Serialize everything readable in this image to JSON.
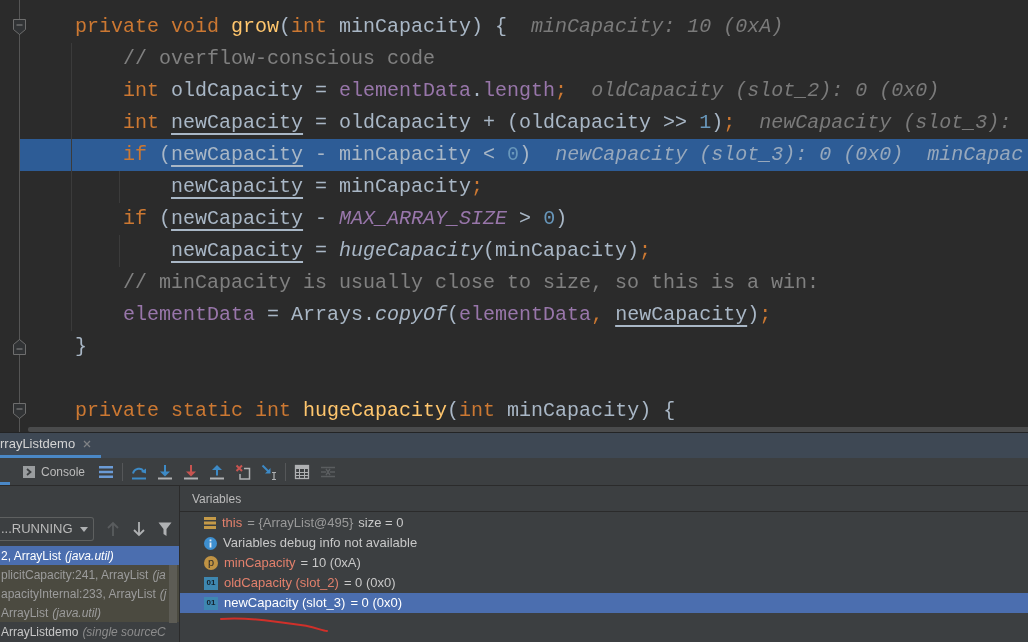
{
  "editor": {
    "lines": [
      {
        "kind": "code",
        "fold_start": true,
        "current": false,
        "tokens": [
          {
            "kind": "keyword",
            "text": "private "
          },
          {
            "kind": "keyword",
            "text": "void "
          },
          {
            "kind": "declaration",
            "text": "grow"
          },
          {
            "kind": "plain",
            "text": "("
          },
          {
            "kind": "keyword",
            "text": "int "
          },
          {
            "kind": "plain",
            "text": "minCapacity) {"
          }
        ],
        "hints": [
          "minCapacity: 10 (0xA)"
        ],
        "children": [
          {
            "kind": "code",
            "current": false,
            "tokens": [
              {
                "kind": "comment",
                "text": "// overflow-conscious code"
              }
            ]
          },
          {
            "kind": "code",
            "current": false,
            "tokens": [
              {
                "kind": "keyword",
                "text": "int "
              },
              {
                "kind": "plain",
                "text": "oldCapacity = "
              },
              {
                "kind": "field",
                "text": "elementData"
              },
              {
                "kind": "plain",
                "text": "."
              },
              {
                "kind": "field",
                "text": "length"
              },
              {
                "kind": "keyword",
                "text": ";"
              }
            ],
            "hints": [
              "oldCapacity (slot_2): 0 (0x0)"
            ]
          },
          {
            "kind": "code",
            "current": false,
            "tokens": [
              {
                "kind": "keyword",
                "text": "int "
              },
              {
                "kind": "local",
                "text": "newCapacity"
              },
              {
                "kind": "plain",
                "text": " = oldCapacity + (oldCapacity >> "
              },
              {
                "kind": "number",
                "text": "1"
              },
              {
                "kind": "plain",
                "text": ")"
              },
              {
                "kind": "keyword",
                "text": ";"
              }
            ],
            "hints": [
              "newCapacity (slot_3):"
            ]
          },
          {
            "kind": "code",
            "current": true,
            "tokens": [
              {
                "kind": "keyword",
                "text": "if "
              },
              {
                "kind": "plain",
                "text": "("
              },
              {
                "kind": "local",
                "text": "newCapacity"
              },
              {
                "kind": "plain",
                "text": " - minCapacity < "
              },
              {
                "kind": "number",
                "text": "0"
              },
              {
                "kind": "plain",
                "text": ")"
              }
            ],
            "hints": [
              "newCapacity (slot_3): 0 (0x0)",
              "minCapac"
            ],
            "children": [
              {
                "kind": "code",
                "current": false,
                "tokens": [
                  {
                    "kind": "local",
                    "text": "newCapacity"
                  },
                  {
                    "kind": "plain",
                    "text": " = minCapacity"
                  },
                  {
                    "kind": "keyword",
                    "text": ";"
                  }
                ]
              }
            ]
          },
          {
            "kind": "code",
            "current": false,
            "tokens": [
              {
                "kind": "keyword",
                "text": "if "
              },
              {
                "kind": "plain",
                "text": "("
              },
              {
                "kind": "local",
                "text": "newCapacity"
              },
              {
                "kind": "plain",
                "text": " - "
              },
              {
                "kind": "constant",
                "text": "MAX_ARRAY_SIZE"
              },
              {
                "kind": "plain",
                "text": " > "
              },
              {
                "kind": "number",
                "text": "0"
              },
              {
                "kind": "plain",
                "text": ")"
              }
            ],
            "children": [
              {
                "kind": "code",
                "current": false,
                "tokens": [
                  {
                    "kind": "local",
                    "text": "newCapacity"
                  },
                  {
                    "kind": "plain",
                    "text": " = "
                  },
                  {
                    "kind": "static_call",
                    "text": "hugeCapacity"
                  },
                  {
                    "kind": "plain",
                    "text": "(minCapacity)"
                  },
                  {
                    "kind": "keyword",
                    "text": ";"
                  }
                ]
              }
            ]
          },
          {
            "kind": "code",
            "current": false,
            "tokens": [
              {
                "kind": "comment",
                "text": "// minCapacity is usually close to size, so this is a win:"
              }
            ]
          },
          {
            "kind": "code",
            "current": false,
            "tokens": [
              {
                "kind": "field",
                "text": "elementData"
              },
              {
                "kind": "plain",
                "text": " = Arrays."
              },
              {
                "kind": "static_call",
                "text": "copyOf"
              },
              {
                "kind": "plain",
                "text": "("
              },
              {
                "kind": "field",
                "text": "elementData"
              },
              {
                "kind": "keyword",
                "text": ", "
              },
              {
                "kind": "local",
                "text": "newCapacity"
              },
              {
                "kind": "plain",
                "text": ")"
              },
              {
                "kind": "keyword",
                "text": ";"
              }
            ]
          }
        ]
      },
      {
        "kind": "code",
        "fold_end": true,
        "current": false,
        "tokens": [
          {
            "kind": "plain",
            "text": "}"
          }
        ]
      },
      {
        "kind": "blank"
      },
      {
        "kind": "code",
        "fold_start": true,
        "current": false,
        "tokens": [
          {
            "kind": "keyword",
            "text": "private "
          },
          {
            "kind": "keyword",
            "text": "static "
          },
          {
            "kind": "keyword",
            "text": "int "
          },
          {
            "kind": "declaration",
            "text": "hugeCapacity"
          },
          {
            "kind": "plain",
            "text": "("
          },
          {
            "kind": "keyword",
            "text": "int "
          },
          {
            "kind": "plain",
            "text": "minCapacity) {"
          }
        ]
      }
    ]
  },
  "debug_panel": {
    "tabs": [
      {
        "label": "rrayListdemo",
        "selected": true
      }
    ],
    "toolbar": {
      "tabs": [
        {
          "selected": true
        },
        {
          "label": "Console",
          "selected": false
        }
      ],
      "tool_groups": [
        [
          {
            "kind": "list",
            "disabled": false
          }
        ],
        [
          {
            "kind": "step_over",
            "disabled": false
          },
          {
            "kind": "step_into",
            "disabled": false
          },
          {
            "kind": "force_step_into",
            "disabled": false
          },
          {
            "kind": "step_out",
            "disabled": false
          },
          {
            "kind": "drop_frame",
            "disabled": false
          },
          {
            "kind": "run_to_cursor",
            "disabled": false
          }
        ],
        [
          {
            "kind": "evaluate",
            "disabled": false
          },
          {
            "kind": "trace",
            "disabled": true
          }
        ]
      ]
    },
    "frames": {
      "thread": "...RUNNING",
      "nav": [
        {
          "kind": "up",
          "disabled": true
        },
        {
          "kind": "down",
          "disabled": false
        },
        {
          "kind": "filter",
          "disabled": false
        }
      ],
      "items": [
        {
          "method": "2, ArrayList",
          "location": "(java.util)",
          "selected": true,
          "library": false
        },
        {
          "method": "plicitCapacity:241, ArrayList",
          "location": "(ja",
          "selected": false,
          "library": true
        },
        {
          "method": "apacityInternal:233, ArrayList",
          "location": "(j",
          "selected": false,
          "library": true
        },
        {
          "method": "ArrayList",
          "location": "(java.util)",
          "selected": false,
          "library": true
        },
        {
          "method": "ArrayListdemo",
          "location": "(single sourceC",
          "selected": false,
          "library": false
        }
      ]
    },
    "variables": {
      "title": "Variables",
      "items": [
        {
          "kind": "object",
          "name": "this",
          "value": "= {ArrayList@495}",
          "detail": "size = 0",
          "selected": false,
          "marked": false
        },
        {
          "kind": "info",
          "text": "Variables debug info not available",
          "selected": false,
          "marked": false
        },
        {
          "kind": "param",
          "badge": "p",
          "name": "minCapacity",
          "value": "= 10 (0xA)",
          "selected": false,
          "marked": false
        },
        {
          "kind": "local",
          "badge": "01",
          "name": "oldCapacity (slot_2)",
          "value": "= 0 (0x0)",
          "selected": false,
          "marked": false
        },
        {
          "kind": "local",
          "badge": "01",
          "name": "newCapacity (slot_3)",
          "value": "= 0 (0x0)",
          "selected": true,
          "marked": true
        }
      ]
    }
  }
}
